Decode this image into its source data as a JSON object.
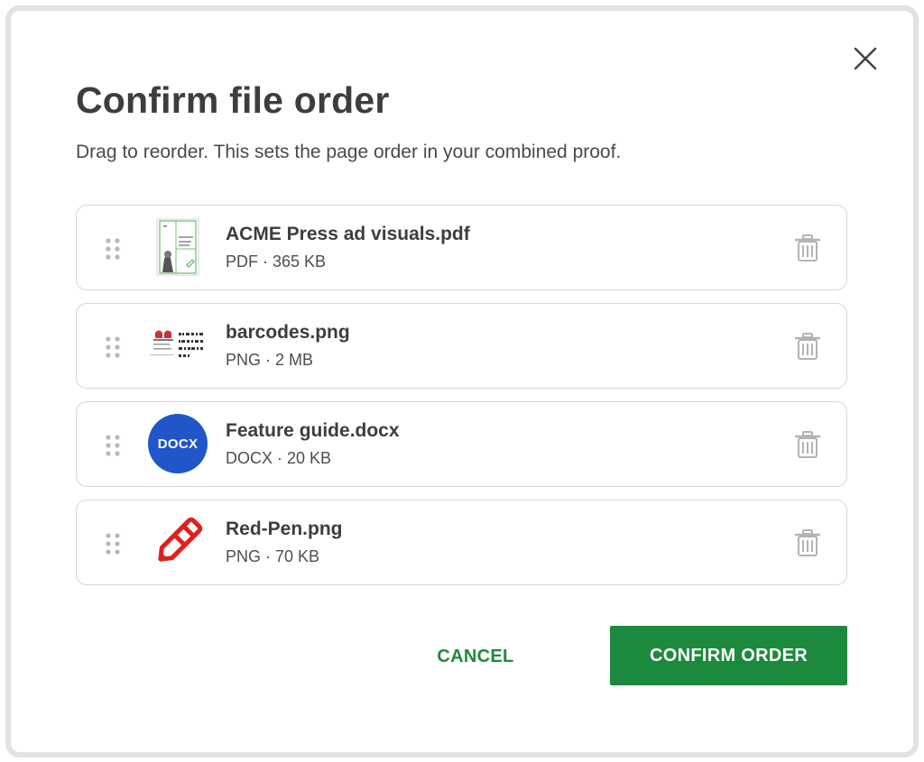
{
  "dialog": {
    "title": "Confirm file order",
    "subtitle": "Drag to reorder. This sets the page order in your combined proof."
  },
  "files": [
    {
      "name": "ACME Press ad visuals.pdf",
      "meta": "PDF · 365 KB",
      "thumbnail": "pdf-page-thumbnail"
    },
    {
      "name": "barcodes.png",
      "meta": "PNG · 2 MB",
      "thumbnail": "barcodes-image-thumbnail"
    },
    {
      "name": "Feature guide.docx",
      "meta": "DOCX · 20 KB",
      "thumbnail": "docx-badge",
      "badge_label": "DOCX"
    },
    {
      "name": "Red-Pen.png",
      "meta": "PNG · 70 KB",
      "thumbnail": "red-pen-image-thumbnail"
    }
  ],
  "actions": {
    "cancel_label": "CANCEL",
    "confirm_label": "CONFIRM ORDER"
  },
  "icons": {
    "close": "close-icon",
    "drag": "drag-handle-icon",
    "delete": "trash-icon"
  },
  "colors": {
    "accent_green": "#1b8a3c",
    "docx_blue": "#2156c8",
    "pen_red": "#e0201c",
    "border": "#d6d6d6"
  }
}
